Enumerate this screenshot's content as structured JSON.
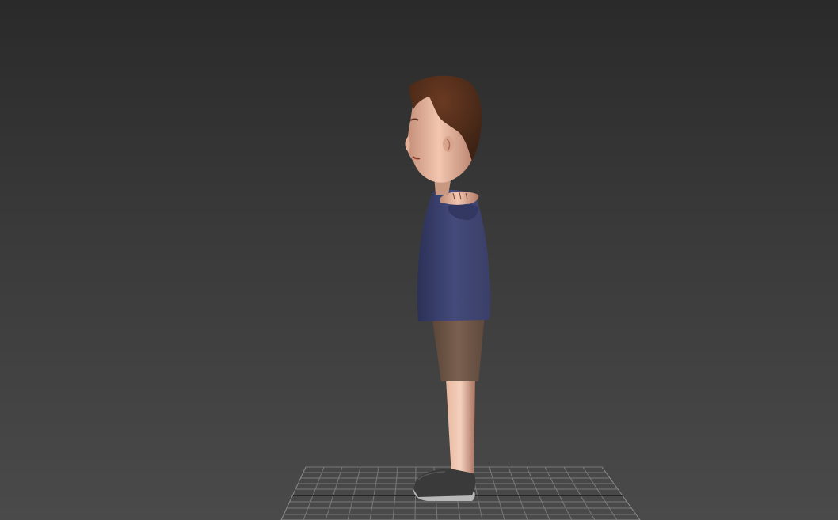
{
  "viewport": {
    "background_top": "#2a2a2a",
    "background_bottom": "#4a4a4a"
  },
  "scene": {
    "grid_color": "#8c8c8c",
    "character": {
      "hair_color": "#4a2a1a",
      "skin_color": "#e8b8a0",
      "shirt_color": "#3a3f68",
      "shorts_color": "#6e5544",
      "shoe_color": "#3a3a3a",
      "sole_color": "#bdbdbd"
    }
  }
}
